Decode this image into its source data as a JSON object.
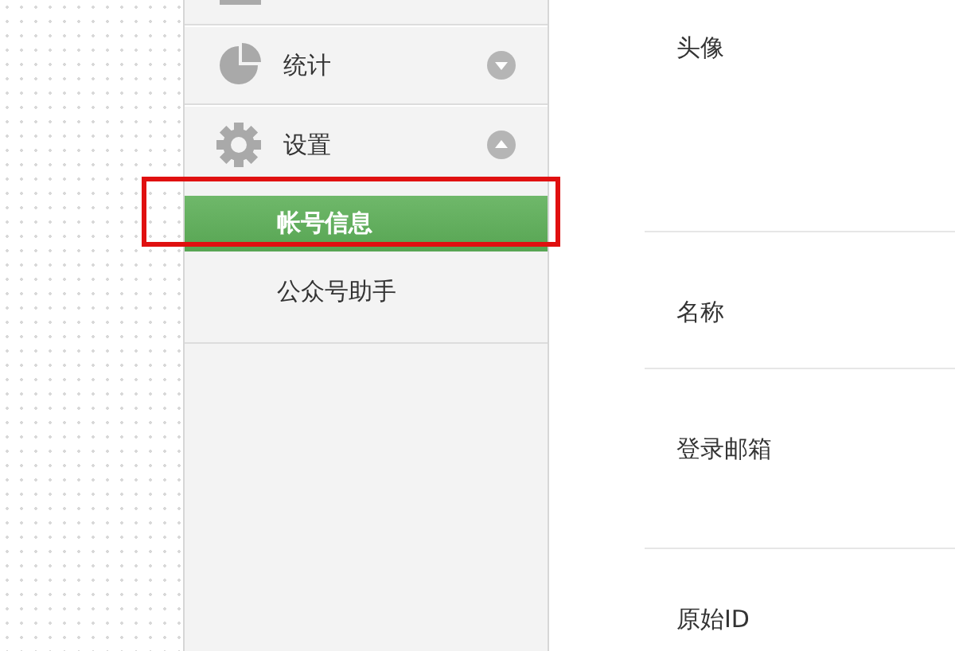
{
  "sidebar": {
    "sections": [
      {
        "kind": "stats",
        "label": "统计",
        "expanded": false
      },
      {
        "kind": "settings",
        "label": "设置",
        "expanded": true,
        "items": [
          {
            "label": "帐号信息",
            "selected": true
          },
          {
            "label": "公众号助手",
            "selected": false
          }
        ]
      }
    ]
  },
  "annotation": {
    "kind": "highlight"
  },
  "content": {
    "fields": [
      {
        "label": "头像"
      },
      {
        "label": "名称"
      },
      {
        "label": "登录邮箱"
      },
      {
        "label": "原始ID"
      }
    ]
  }
}
